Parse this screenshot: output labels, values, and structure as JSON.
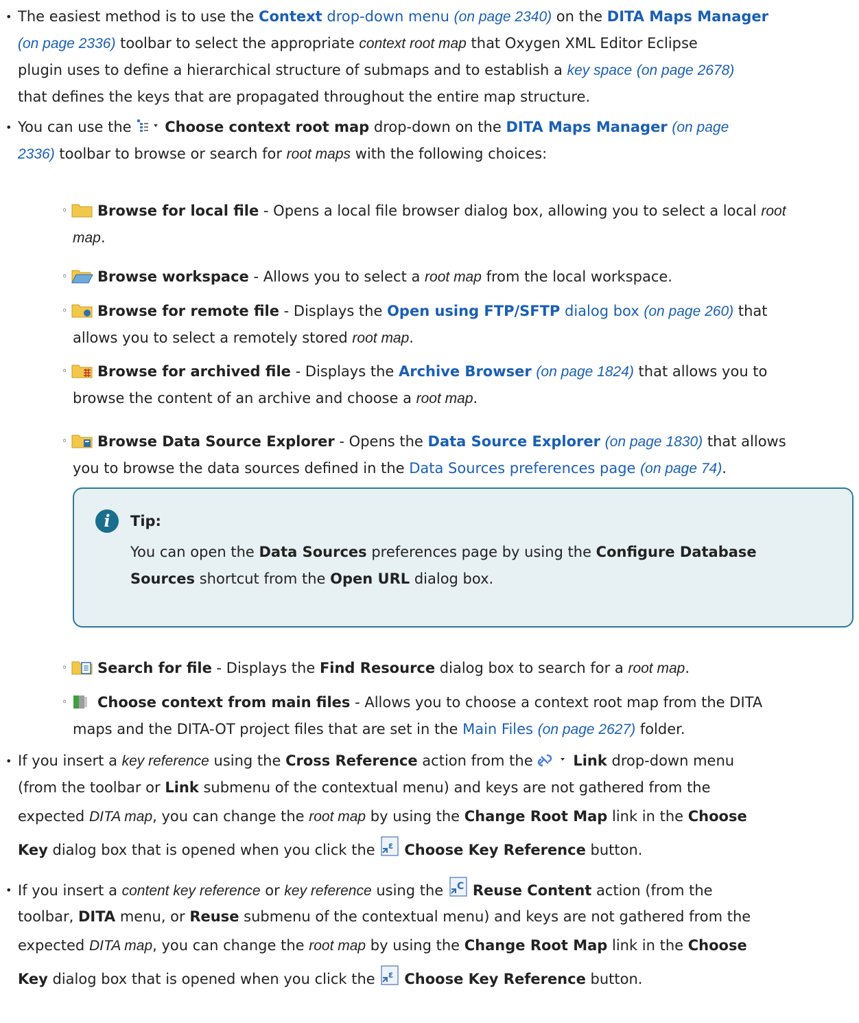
{
  "bullet1": {
    "pre": "The easiest method is to use the ",
    "context": "Context",
    "dropdown_menu": " drop-down menu",
    "page_2340": "(on page 2340)",
    "on_the": " on the ",
    "dmm": "DITA Maps Manager",
    "page_2336": "(on page 2336)",
    "line2_rest": " toolbar to select the appropriate ",
    "context_root_map": "context root map",
    "line2_tail": " that Oxygen XML Editor Eclipse",
    "line3_pre": "plugin uses to define a hierarchical structure of submaps and to establish a ",
    "key_space": "key space",
    "page_2678": "(on page 2678)",
    "line4": "that defines the keys that are propagated throughout the entire map structure."
  },
  "bullet2": {
    "pre": "You can use the ",
    "choose_ctx": "Choose context root map",
    "mid": " drop-down on the ",
    "dmm": "DITA Maps Manager",
    "page_prefix": "(on page",
    "page_num": "2336)",
    "line2_rest": " toolbar to browse or search for ",
    "root_maps": "root maps",
    "line2_tail": " with the following choices:"
  },
  "sub": {
    "local_label": "Browse for local file",
    "local_text": " - Opens a local file browser dialog box, allowing you to select a local ",
    "root": "root",
    "map_dot": "map",
    "dot": ".",
    "ws_label": "Browse workspace",
    "ws_text": " - Allows you to select a ",
    "root_map": "root map",
    "ws_tail": " from the local workspace.",
    "remote_label": "Browse for remote file",
    "remote_text": " - Displays the ",
    "open_ftp": "Open using FTP/SFTP",
    "dialog_box": " dialog box ",
    "page_260": "(on page 260)",
    "that": " that",
    "remote_line2": "allows you to select a remotely stored ",
    "archived_label": "Browse for archived file",
    "archived_text": " - Displays the ",
    "archive_browser": "Archive Browser",
    "page_1824": "(on page 1824)",
    "archived_tail": " that allows you to",
    "archived_line2": "browse the content of an archive and choose a ",
    "dse_label": "Browse Data Source Explorer",
    "dse_text": " - Opens the ",
    "dse_link": "Data Source Explorer",
    "page_1830": "(on page 1830)",
    "dse_tail": " that allows",
    "dse_line2": "you to browse the data sources defined in the ",
    "ds_prefs": "Data Sources preferences page",
    "page_74": "(on page 74)",
    "search_label": "Search for file",
    "search_text": " - Displays the ",
    "find_resource": "Find Resource",
    "search_tail": " dialog box to search for a ",
    "main_label": "Choose context from main files",
    "main_text": " - Allows you to choose a context root map from the DITA",
    "main_line2": "maps and the DITA-OT project files that are set in the ",
    "main_files": "Main Files",
    "page_2627": "(on page 2627)",
    "folder": " folder."
  },
  "tip": {
    "title": "Tip:",
    "t1": "You can open the ",
    "data_sources": "Data Sources",
    "t2": " preferences page by using the ",
    "configure": "Configure Database",
    "sources": "Sources",
    "t3": " shortcut from the ",
    "open_url": "Open URL",
    "t4": " dialog box."
  },
  "bullet3": {
    "pre": "If you insert a ",
    "key_reference": "key reference",
    "mid": " using the ",
    "cross_ref": "Cross Reference",
    "mid2": " action from the ",
    "link": "Link",
    "tail": " drop-down menu",
    "l2_pre": "(from the toolbar or ",
    "l2_tail": " submenu of the contextual menu) and keys are not gathered from the",
    "l3_pre": "expected ",
    "dita_map": "DITA map",
    "l3_mid": ", you can change the ",
    "root_map": "root map",
    "l3_mid2": " by using the ",
    "change_root": "Change Root Map",
    "l3_mid3": " link in the ",
    "choose": "Choose",
    "key": "Key",
    "l4_mid": " dialog box that is opened when you click the ",
    "choose_key_ref": "Choose Key Reference",
    "button": " button."
  },
  "bullet4": {
    "pre": "If you insert a ",
    "content_key_ref": "content key reference",
    "or": " or ",
    "key_reference": "key reference",
    "mid": " using the ",
    "reuse_content": "Reuse Content",
    "tail": " action (from the",
    "l2_pre": "toolbar, ",
    "dita": "DITA",
    "l2_mid": " menu, or ",
    "reuse": "Reuse",
    "l2_tail": " submenu of the contextual menu) and keys are not gathered from the"
  },
  "icons": {
    "colors": {
      "folder": "#f2c84b",
      "folder_dark": "#c99a1f",
      "link_blue": "#1a5fb4",
      "tip_border": "#2a7a9a",
      "tip_bg": "#e7f0f3"
    }
  }
}
